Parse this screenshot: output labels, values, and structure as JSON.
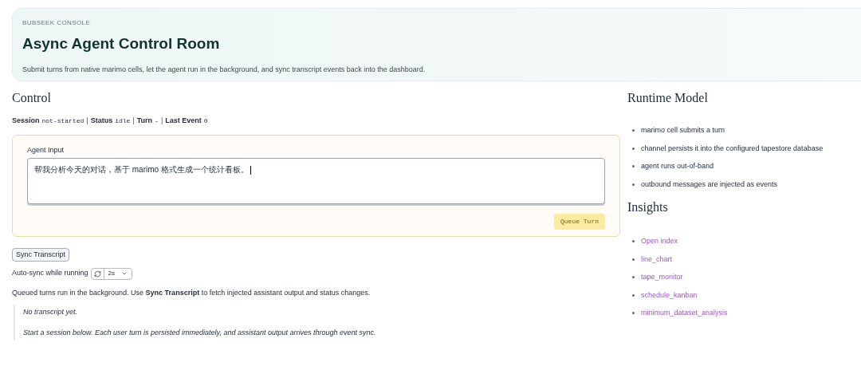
{
  "header": {
    "eyebrow": "BUBSEEK CONSOLE",
    "title": "Async Agent Control Room",
    "subtitle": "Submit turns from native marimo cells, let the agent run in the background, and sync transcript events back into the dashboard."
  },
  "control": {
    "heading": "Control",
    "status_separator": "|",
    "status": [
      {
        "label": "Session",
        "value": "not-started"
      },
      {
        "label": "Status",
        "value": "idle"
      },
      {
        "label": "Turn",
        "value": "-"
      },
      {
        "label": "Last Event",
        "value": "0"
      }
    ],
    "input": {
      "label": "Agent Input",
      "value": "帮我分析今天的对话，基于 marimo 格式生成一个统计看板。",
      "focused": true
    },
    "queue_button": "Queue Turn",
    "sync_button": "Sync Transcript",
    "auto_sync": {
      "label": "Auto-sync while running",
      "interval": "2s"
    },
    "note": "Queued turns run in the background. Use **Sync Transcript** to fetch injected assistant output and status changes.",
    "transcript": [
      "No transcript yet.",
      "Start a session below. Each user turn is persisted immediately, and assistant output arrives through event sync."
    ]
  },
  "runtime_model": {
    "heading": "Runtime Model",
    "items": [
      "marimo cell submits a turn",
      "channel persists it into the configured tapestore database",
      "agent runs out-of-band",
      "outbound messages are injected as events"
    ]
  },
  "insights": {
    "heading": "Insights",
    "links": [
      "Open index",
      "line_chart",
      "tape_monitor",
      "schedule_kanban",
      "minimum_dataset_analysis"
    ]
  }
}
